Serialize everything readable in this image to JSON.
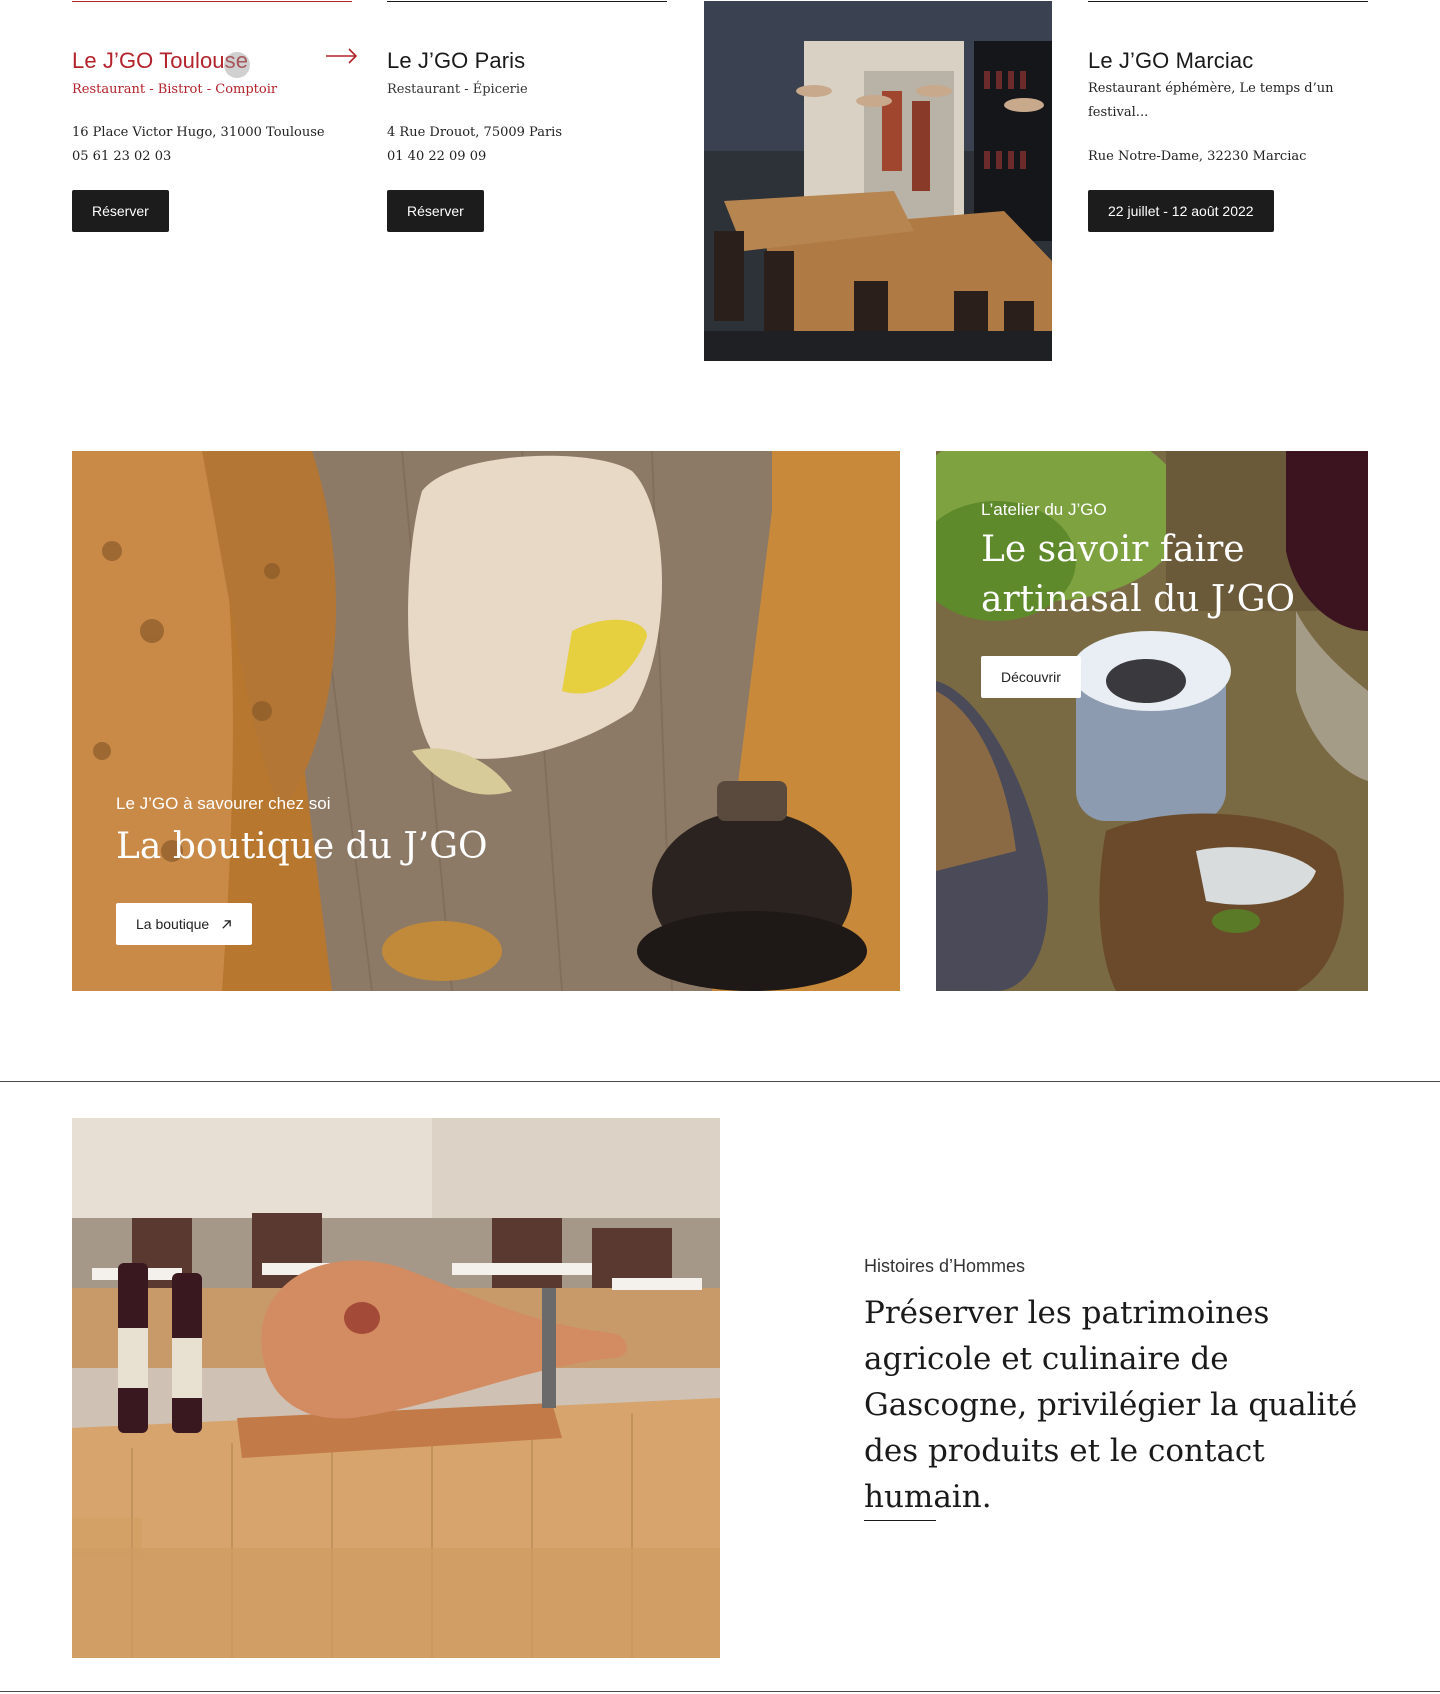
{
  "restaurants": [
    {
      "name": "Le J’GO Toulouse",
      "tags": "Restaurant  -  Bistrot  -  Comptoir",
      "address": "16 Place Victor Hugo, 31000 Toulouse",
      "phone": "05 61 23 02 03",
      "button": "Réserver",
      "state": "hover",
      "accent_color": "#b3232b",
      "arrow_icon": "arrow-right-icon"
    },
    {
      "name": "Le J’GO Paris",
      "tags": "Restaurant  -  Épicerie",
      "address": "4 Rue Drouot, 75009 Paris",
      "phone": "01 40 22 09 09",
      "button": "Réserver"
    },
    {
      "name": "Le J’GO Marciac",
      "tags_line1": "Restaurant éphémère, Le temps d’un",
      "tags_line2": "festival...",
      "address": "Rue Notre-Dame, 32230 Marciac",
      "button": "22 juillet - 12 août 2022"
    }
  ],
  "boutique": {
    "eyebrow": "Le J’GO à savourer chez soi",
    "title": "La boutique du J’GO",
    "button": "La boutique",
    "button_icon": "external-arrow-icon"
  },
  "atelier": {
    "eyebrow": "L’atelier du J’GO",
    "title_line1": "Le savoir faire",
    "title_line2": "artinasal du J’GO",
    "button": "Découvrir"
  },
  "story": {
    "eyebrow": "Histoires d’Hommes",
    "quote": "Préserver les patrimoines agricole et culinaire de Gascogne, privilégier la qualité des produits et le contact humain."
  },
  "colors": {
    "accent": "#b3232b",
    "button_dark": "#1c1c1c",
    "text": "#1a1a1a"
  }
}
